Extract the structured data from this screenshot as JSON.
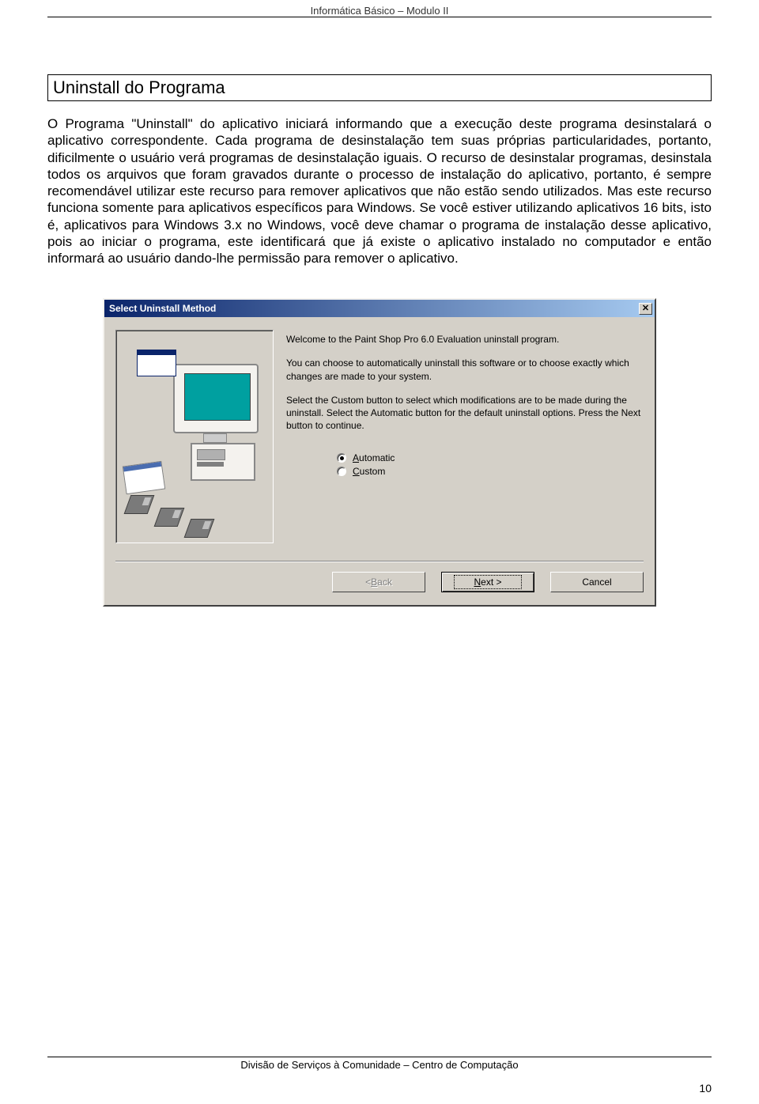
{
  "header": "Informática Básico – Modulo II",
  "section_title": "Uninstall do Programa",
  "body_text": "O Programa \"Uninstall\" do aplicativo iniciará informando que a execução deste programa desinstalará o aplicativo correspondente. Cada programa de desinstalação tem suas próprias particularidades, portanto, dificilmente o usuário verá programas de desinstalação iguais. O recurso de desinstalar programas, desinstala todos os arquivos que foram gravados durante o processo de instalação do aplicativo, portanto, é sempre recomendável utilizar este recurso para remover aplicativos que não estão sendo utilizados. Mas este recurso funciona somente para aplicativos específicos para Windows. Se você estiver utilizando aplicativos 16 bits, isto é, aplicativos para Windows 3.x no Windows, você deve chamar o programa de instalação desse aplicativo, pois ao iniciar o programa, este identificará que já existe o aplicativo instalado no computador e então informará ao usuário dando-lhe permissão para remover o aplicativo.",
  "dialog": {
    "title": "Select Uninstall Method",
    "para1": "Welcome to the Paint Shop Pro 6.0 Evaluation uninstall program.",
    "para2": "You can choose to automatically uninstall this software or to choose exactly which changes are made to your system.",
    "para3": "Select the Custom button to select which modifications are to be made during the uninstall. Select the Automatic button for the default uninstall options. Press the Next button to continue.",
    "radio1": "Automatic",
    "radio2": "Custom",
    "back": "< Back",
    "next": "Next >",
    "cancel": "Cancel"
  },
  "footer": "Divisão de Serviços à Comunidade – Centro de Computação",
  "page_number": "10"
}
